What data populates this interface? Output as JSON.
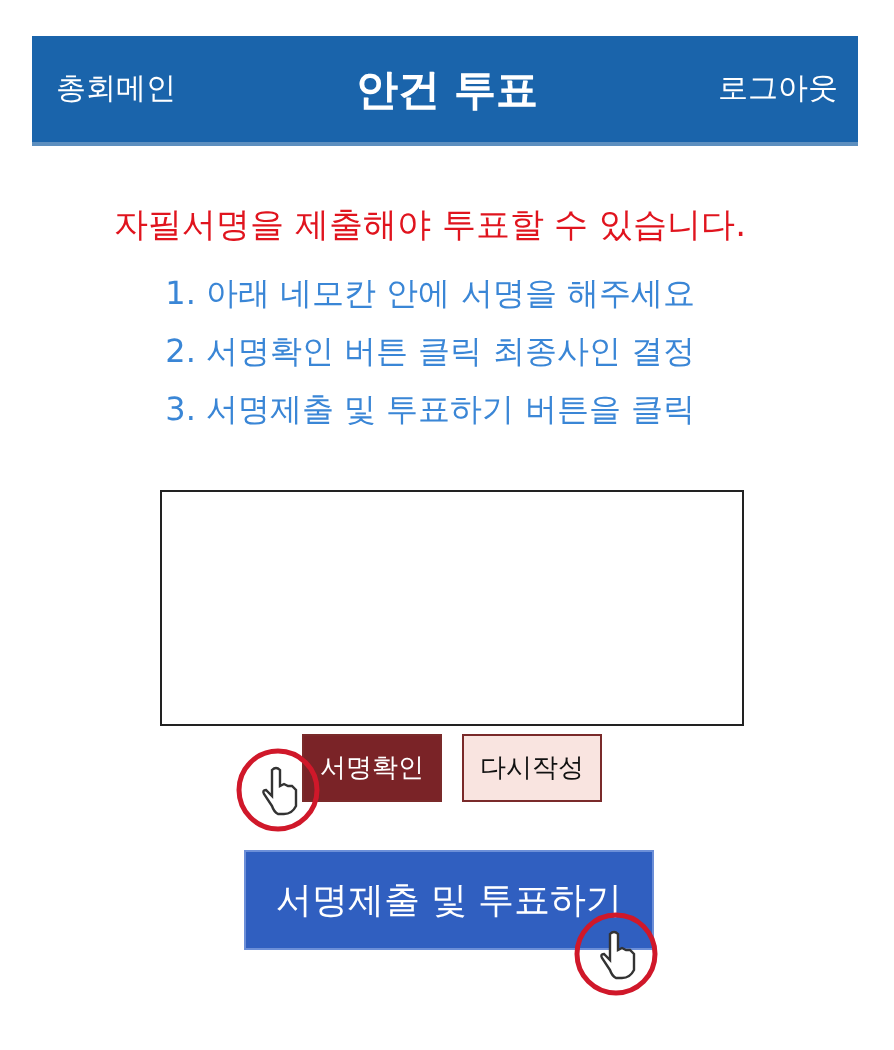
{
  "header": {
    "left_link": "총회메인",
    "title": "안건 투표",
    "right_link": "로그아웃"
  },
  "notice": "자필서명을 제출해야 투표할 수 있습니다.",
  "steps": [
    "1. 아래 네모칸 안에 서명을 해주세요",
    "2. 서명확인 버튼 클릭 최종사인 결정",
    "3. 서명제출 및 투표하기 버튼을 클릭"
  ],
  "signature_buttons": [
    {
      "label": "서명확인",
      "kind": "primary"
    },
    {
      "label": "다시작성",
      "kind": "secondary"
    }
  ],
  "submit_button": "서명제출 및 투표하기"
}
